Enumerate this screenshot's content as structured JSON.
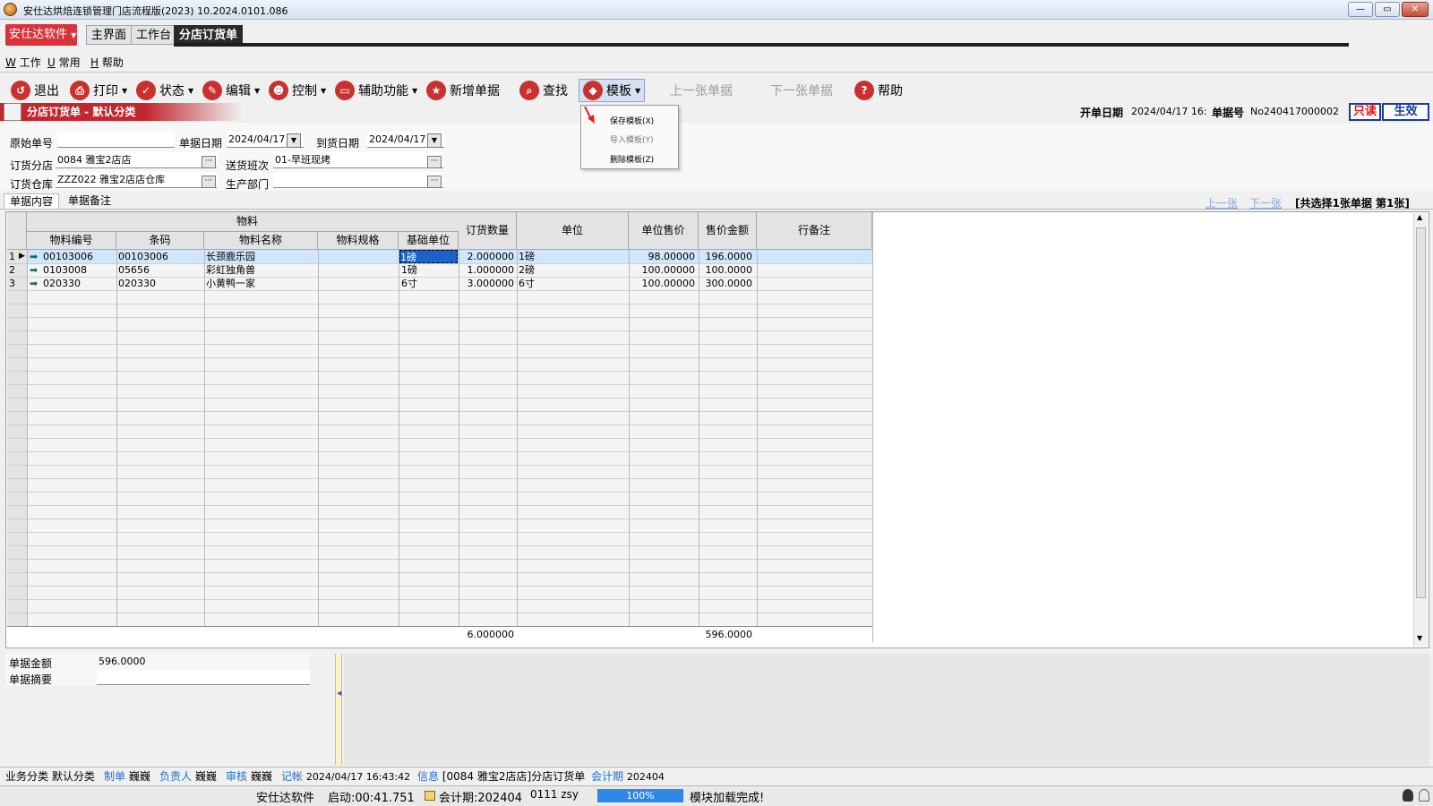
{
  "window": {
    "title": "安仕达烘焙连锁管理门店流程版(2023)    10.2024.0101.086",
    "minimize": "—",
    "maximize": "▭",
    "close": "✕"
  },
  "brand_button": "安仕达软件",
  "tabs": [
    "主界面",
    "工作台",
    "分店订货单"
  ],
  "menu": [
    {
      "key": "W",
      "label": "工作"
    },
    {
      "key": "U",
      "label": "常用"
    },
    {
      "key": "H",
      "label": "帮助"
    }
  ],
  "toolbar": {
    "exit": "退出",
    "print": "打印",
    "status": "状态",
    "edit": "编辑",
    "control": "控制",
    "aux": "辅助功能",
    "new_doc": "新增单据",
    "find": "查找",
    "template": "模板",
    "prev_doc": "上一张单据",
    "next_doc": "下一张单据",
    "help": "帮助"
  },
  "template_menu": {
    "save": "保存模板(X)",
    "import": "导入模板(Y)",
    "delete": "删除模板(Z)"
  },
  "form_header": {
    "title": "分店订货单 - 默认分类",
    "open_date_label": "开单日期",
    "open_date_value": "2024/04/17 16:",
    "doc_no_label": "单据号",
    "doc_no_value": "No240417000002",
    "readonly_badge": "只读",
    "effective_badge": "生效"
  },
  "form": {
    "orig_no_label": "原始单号",
    "orig_no_value": "",
    "doc_date_label": "单据日期",
    "doc_date_value": "2024/04/17",
    "arrival_date_label": "到货日期",
    "arrival_date_value": "2024/04/17",
    "branch_label": "订货分店",
    "branch_value": "0084  雅宝2店店",
    "shift_label": "送货班次",
    "shift_value": "01-早班现烤",
    "warehouse_label": "订货仓库",
    "warehouse_value": "ZZZ022  雅宝2店店仓库",
    "dept_label": "生产部门",
    "dept_value": ""
  },
  "subtabs": [
    "单据内容",
    "单据备注"
  ],
  "pager": {
    "prev": "上一张",
    "next": "下一张",
    "summary": "[共选择1张单据  第1张]"
  },
  "grid": {
    "group_header": "物料",
    "columns": [
      "物料编号",
      "条码",
      "物料名称",
      "物料规格",
      "基础单位",
      "订货数量",
      "单位",
      "单位售价",
      "售价金额",
      "行备注"
    ],
    "rows": [
      {
        "idx": "1",
        "code": "00103006",
        "barcode": "00103006",
        "name": "长颈鹿乐园",
        "spec": "",
        "base_unit": "1磅",
        "qty": "2.000000",
        "unit": "1磅",
        "price": "98.00000",
        "amount": "196.0000",
        "remark": ""
      },
      {
        "idx": "2",
        "code": "0103008",
        "barcode": "05656",
        "name": "彩虹独角兽",
        "spec": "",
        "base_unit": "1磅",
        "qty": "1.000000",
        "unit": "2磅",
        "price": "100.00000",
        "amount": "100.0000",
        "remark": ""
      },
      {
        "idx": "3",
        "code": "020330",
        "barcode": "020330",
        "name": "小黄鸭一家",
        "spec": "",
        "base_unit": "6寸",
        "qty": "3.000000",
        "unit": "6寸",
        "price": "100.00000",
        "amount": "300.0000",
        "remark": ""
      }
    ],
    "total_qty": "6.000000",
    "total_amount": "596.0000"
  },
  "summary": {
    "amount_label": "单据金额",
    "amount_value": "596.0000",
    "memo_label": "单据摘要",
    "memo_value": ""
  },
  "statusbar": {
    "category_label": "业务分类",
    "category_value": "默认分类",
    "maker_label": "制单",
    "maker_value": "巍巍",
    "owner_label": "负责人",
    "owner_value": "巍巍",
    "audit_label": "审核",
    "audit_value": "巍巍",
    "post_label": "记帐",
    "post_value": "2024/04/17 16:43:42",
    "info_label": "信息",
    "info_value": "[0084 雅宝2店店]分店订货单",
    "period_label": "会计期",
    "period_value": "202404"
  },
  "statusbar2": {
    "company": "安仕达软件",
    "uptime": "启动:00:41.751",
    "period": "会计期:202404",
    "user": "0111 zsy",
    "progress": "100%",
    "message": "模块加载完成!"
  },
  "colors": {
    "brand_red": "#d8323a",
    "selected_row": "#cfe6fb",
    "link_blue": "#1f6fd0",
    "progress_blue": "#2f86e6"
  }
}
